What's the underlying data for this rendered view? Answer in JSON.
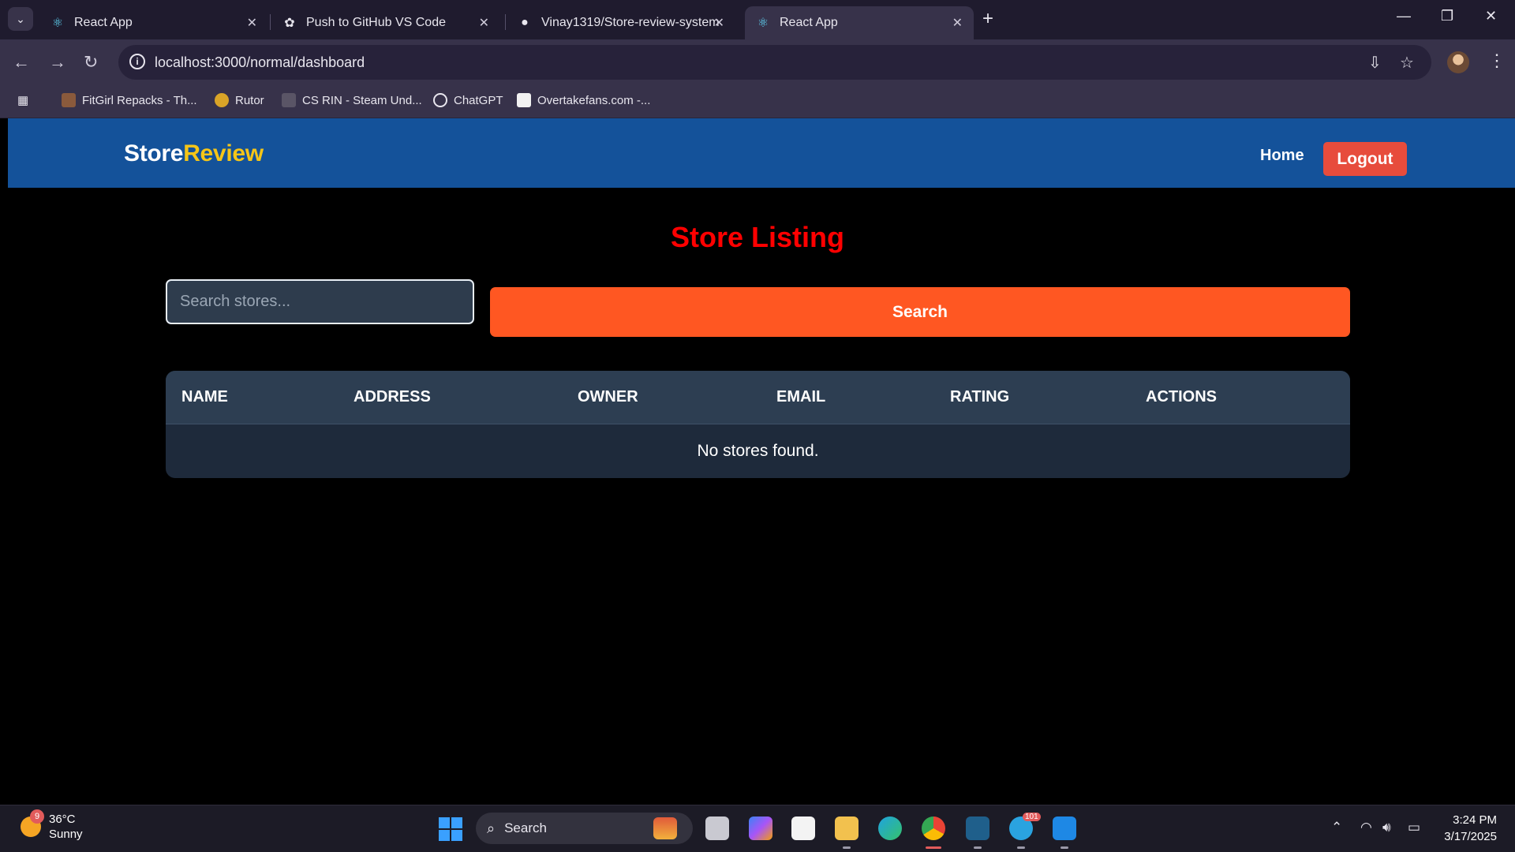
{
  "browser": {
    "tabs": [
      {
        "title": "React App",
        "icon": "react-icon"
      },
      {
        "title": "Push to GitHub VS Code",
        "icon": "chatgpt-icon"
      },
      {
        "title": "Vinay1319/Store-review-system",
        "icon": "github-icon"
      },
      {
        "title": "React App",
        "icon": "react-icon",
        "active": true
      }
    ],
    "url": "localhost:3000/normal/dashboard",
    "bookmarks": [
      {
        "label": "FitGirl Repacks - Th...",
        "icon": "fitgirl-icon"
      },
      {
        "label": "Rutor",
        "icon": "rutor-icon"
      },
      {
        "label": "CS RIN - Steam Und...",
        "icon": "csrin-icon"
      },
      {
        "label": "ChatGPT",
        "icon": "chatgpt-icon"
      },
      {
        "label": "Overtakefans.com -...",
        "icon": "overtake-icon"
      }
    ]
  },
  "app": {
    "brand": {
      "part1": "Store",
      "part2": "Review"
    },
    "nav": {
      "home": "Home",
      "logout": "Logout"
    },
    "title": "Store Listing",
    "search": {
      "placeholder": "Search stores...",
      "value": "",
      "button": "Search"
    },
    "table": {
      "columns": [
        "NAME",
        "ADDRESS",
        "OWNER",
        "EMAIL",
        "RATING",
        "ACTIONS"
      ],
      "empty_message": "No stores found."
    },
    "colors": {
      "navbar": "#14529a",
      "accent": "#f5c518",
      "title": "#ff0000",
      "search_button": "#ff5722",
      "logout": "#e74c3c"
    }
  },
  "taskbar": {
    "weather": {
      "temp": "36°C",
      "condition": "Sunny",
      "badge": "9"
    },
    "search_label": "Search",
    "time": "3:24 PM",
    "date": "3/17/2025",
    "telegram_badge": "101"
  }
}
